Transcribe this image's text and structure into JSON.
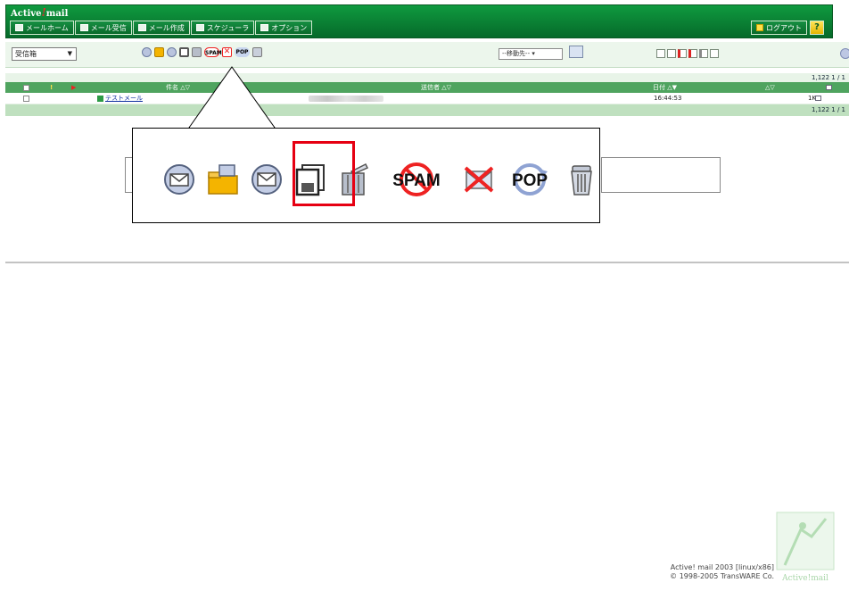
{
  "brand": {
    "prefix": "Active",
    "slash": "!",
    "suffix": "mail"
  },
  "nav": {
    "items": [
      {
        "label": "メールホーム",
        "icon": "home-icon"
      },
      {
        "label": "メール受信",
        "icon": "inbox-icon"
      },
      {
        "label": "メール作成",
        "icon": "compose-icon"
      },
      {
        "label": "スケジューラ",
        "icon": "calendar-icon"
      },
      {
        "label": "オプション",
        "icon": "options-icon"
      }
    ],
    "logout_label": "ログアウト",
    "help_label": "?"
  },
  "toolbar": {
    "folder_select": "受信箱",
    "move_select": "--移動先--",
    "mini_spam": "SPAM",
    "mini_pop": "POP"
  },
  "list": {
    "top_count": "1,122  1 / 1",
    "bottom_count": "1,122  1 / 1",
    "headers": {
      "subject": "件名",
      "sender": "送信者",
      "date": "日付",
      "sort": "△▽",
      "sort_active": "△▼"
    },
    "rows": [
      {
        "subject": "テストメール",
        "date": "16:44:53",
        "size": "1K"
      }
    ]
  },
  "zoom": {
    "icons": [
      "receive-icon",
      "move-folder-icon",
      "read-all-icon",
      "save-icon",
      "delete-icon",
      "spam-icon",
      "not-spam-icon",
      "pop-icon",
      "trash-icon"
    ],
    "spam_label": "SPAM",
    "pop_label": "POP",
    "highlight_color": "#e60012"
  },
  "footer": {
    "line1": "Active! mail 2003 [linux/x86]",
    "line2": "© 1998-2005 TransWARE Co.",
    "watermark": "Active!mail"
  },
  "colors": {
    "header_green": "#0a7a32",
    "list_header_green": "#4fa45f",
    "highlight_red": "#e60012"
  }
}
